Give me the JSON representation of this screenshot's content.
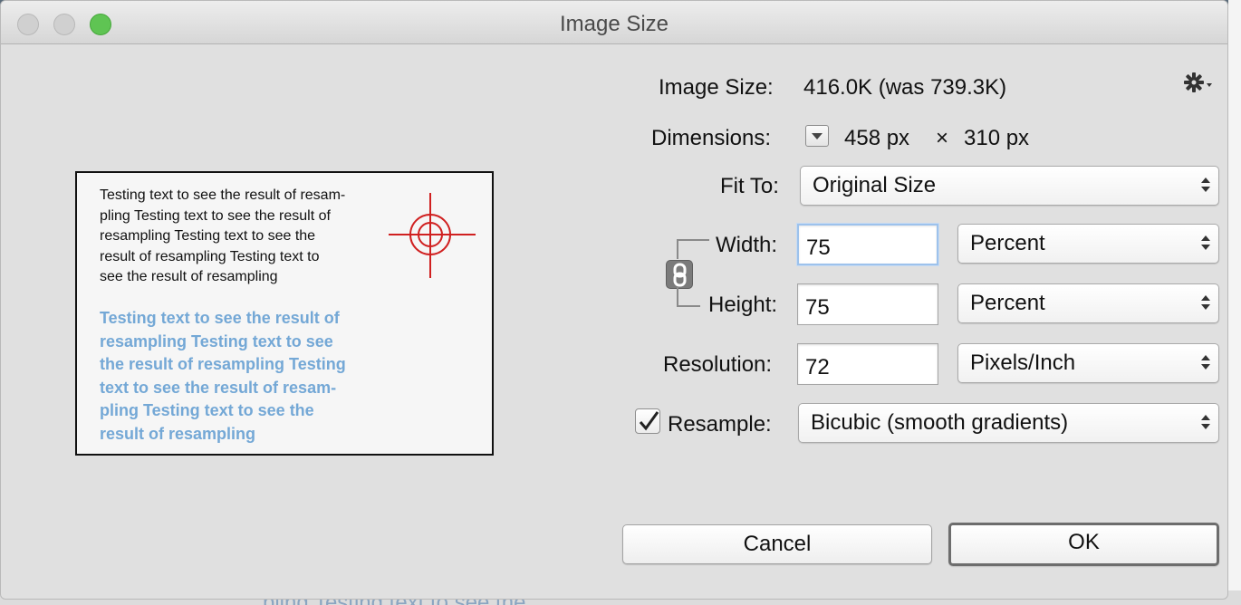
{
  "window": {
    "title": "Image Size"
  },
  "preview": {
    "black_lines": [
      "Testing text to see the result of resam-",
      "pling  Testing text to see the result of",
      "resampling  Testing text to see the",
      "result of resampling  Testing text to",
      "see the result of resampling"
    ],
    "blue_lines": [
      "Testing text to see the result of",
      "resampling  Testing text to see",
      "the result of resampling  Testing",
      "text to see the result of resam-",
      "pling  Testing text to see the",
      "result of resampling"
    ],
    "crosshair_icon": "target-crosshair-icon",
    "crosshair_color": "#d02020"
  },
  "info": {
    "image_size_label": "Image Size:",
    "image_size_value": "416.0K (was 739.3K)",
    "dimensions_label": "Dimensions:",
    "dim_width": "458 px",
    "dim_times": "×",
    "dim_height": "310 px",
    "gear_icon": "gear-icon"
  },
  "fit_to": {
    "label": "Fit To:",
    "selected": "Original Size"
  },
  "width": {
    "label": "Width:",
    "value": "75",
    "unit": "Percent"
  },
  "height": {
    "label": "Height:",
    "value": "75",
    "unit": "Percent"
  },
  "constrain_icon": "chain-link-icon",
  "resolution": {
    "label": "Resolution:",
    "value": "72",
    "unit": "Pixels/Inch"
  },
  "resample": {
    "label": "Resample:",
    "checked": true,
    "method": "Bicubic (smooth gradients)"
  },
  "buttons": {
    "cancel": "Cancel",
    "ok": "OK"
  },
  "backdrop": {
    "partial_text": "pling  Testing text to see the"
  },
  "colors": {
    "focus_ring": "#9dc2ec",
    "zoom_button": "#5fc453",
    "blue_text": "#74a8d6"
  }
}
